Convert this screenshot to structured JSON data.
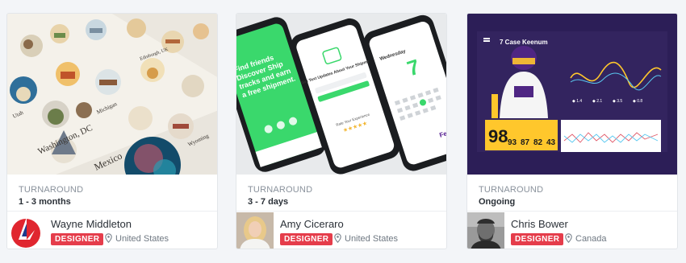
{
  "cards": [
    {
      "turnaround_label": "TURNAROUND",
      "turnaround_value": "1 - 3 months",
      "name": "Wayne Middleton",
      "role": "DESIGNER",
      "location": "United States",
      "thumb_labels": [
        "Washington, DC",
        "Mexico",
        "Wyoming",
        "Utah",
        "Michigan",
        "Edinburgh, UK"
      ],
      "avatar_icon": "red-flag-logo-icon"
    },
    {
      "turnaround_label": "TURNAROUND",
      "turnaround_value": "3 - 7 days",
      "name": "Amy Ciceraro",
      "role": "DESIGNER",
      "location": "United States",
      "thumb_labels": [
        "Find friends Discover Ship tracks and earn a free shipment.",
        "Get Text Updates About Your Shipment",
        "Rate Your Experience",
        "Wednesday",
        "7"
      ],
      "avatar_icon": "blonde-woman-avatar"
    },
    {
      "turnaround_label": "TURNAROUND",
      "turnaround_value": "Ongoing",
      "name": "Chris Bower",
      "role": "DESIGNER",
      "location": "Canada",
      "thumb_labels": [
        "7 Case Keenum",
        "98",
        "93",
        "87",
        "82",
        "43"
      ],
      "avatar_icon": "bearded-man-avatar"
    }
  ],
  "colors": {
    "badge": "#e53d4b",
    "page_background": "#f3f5f8",
    "app_green": "#3ad86c",
    "dashboard_purple": "#2c1e57",
    "dashboard_gold": "#ffc72c"
  }
}
